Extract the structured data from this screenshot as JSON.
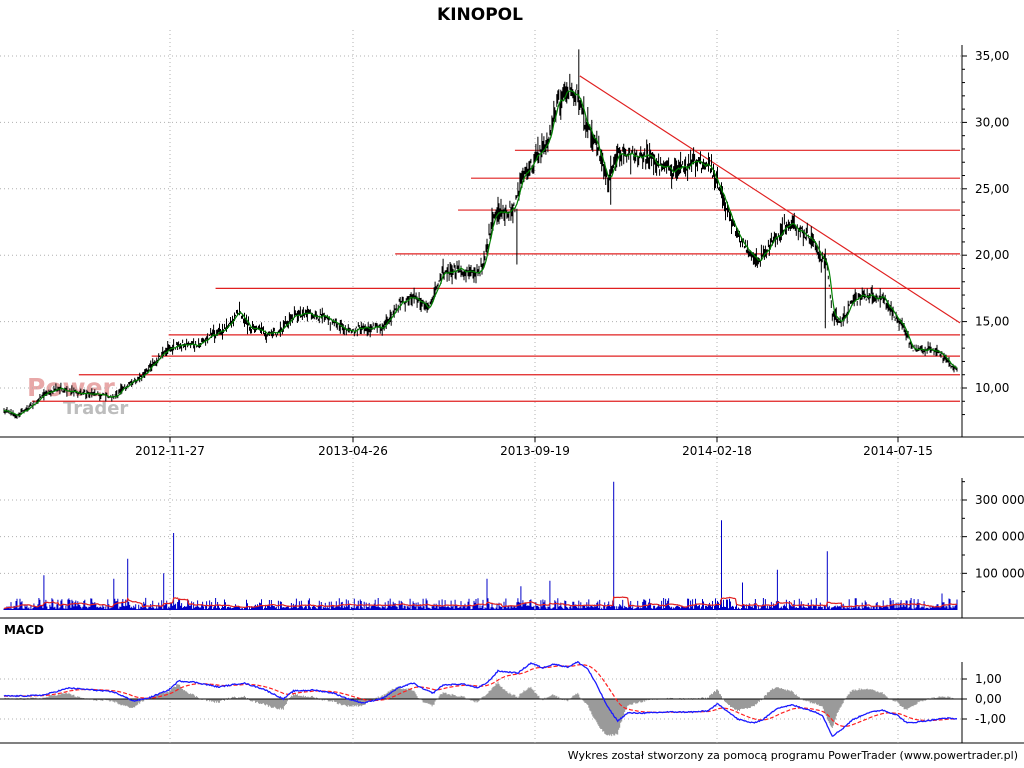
{
  "title": "KINOPOL",
  "watermark": {
    "line1": "Power",
    "line2": "Trader"
  },
  "footer": "Wykres został stworzony za pomocą programu PowerTrader (www.powertrader.pl)",
  "colors": {
    "price_bars": "#000000",
    "price_ma": "#008000",
    "support_lines": "#e02020",
    "volume_bars": "#0000c8",
    "volume_ma": "#e02020",
    "macd_line": "#1a1aff",
    "macd_signal": "#ff2020",
    "histogram": "#9a9a9a",
    "grid": "#b0b0b0"
  },
  "chart_data": [
    {
      "type": "ohlc",
      "pane": "price",
      "x_tick_labels": [
        "2012-11-27",
        "2013-04-26",
        "2013-09-19",
        "2014-02-18",
        "2014-07-15"
      ],
      "ylim": [
        7.0,
        35.5
      ],
      "y_ticks": [
        10,
        15,
        20,
        25,
        30,
        35
      ],
      "y_tick_labels": [
        "10,00",
        "15,00",
        "20,00",
        "25,00",
        "30,00",
        "35,00"
      ],
      "close_waypoints": [
        [
          0,
          8.3
        ],
        [
          12,
          7.9
        ],
        [
          25,
          8.5
        ],
        [
          40,
          9.5
        ],
        [
          55,
          10.0
        ],
        [
          75,
          9.6
        ],
        [
          95,
          9.5
        ],
        [
          110,
          9.3
        ],
        [
          125,
          10.3
        ],
        [
          135,
          10.7
        ],
        [
          150,
          11.8
        ],
        [
          160,
          12.8
        ],
        [
          175,
          13.2
        ],
        [
          195,
          13.3
        ],
        [
          210,
          14.0
        ],
        [
          225,
          14.6
        ],
        [
          235,
          15.8
        ],
        [
          245,
          14.6
        ],
        [
          260,
          14.2
        ],
        [
          275,
          14.2
        ],
        [
          290,
          15.4
        ],
        [
          305,
          15.6
        ],
        [
          320,
          15.3
        ],
        [
          335,
          14.8
        ],
        [
          345,
          14.2
        ],
        [
          360,
          14.6
        ],
        [
          380,
          14.6
        ],
        [
          395,
          16.3
        ],
        [
          410,
          16.9
        ],
        [
          425,
          16.0
        ],
        [
          440,
          18.6
        ],
        [
          455,
          19.0
        ],
        [
          470,
          18.6
        ],
        [
          480,
          19.0
        ],
        [
          490,
          23.0
        ],
        [
          500,
          23.4
        ],
        [
          510,
          23.3
        ],
        [
          520,
          26.0
        ],
        [
          530,
          27.0
        ],
        [
          545,
          28.5
        ],
        [
          555,
          31.5
        ],
        [
          565,
          32.5
        ],
        [
          575,
          32.0
        ],
        [
          585,
          29.5
        ],
        [
          595,
          28.0
        ],
        [
          605,
          25.5
        ],
        [
          615,
          27.5
        ],
        [
          630,
          27.5
        ],
        [
          645,
          27.5
        ],
        [
          660,
          26.5
        ],
        [
          675,
          26.5
        ],
        [
          690,
          26.8
        ],
        [
          705,
          27.0
        ],
        [
          715,
          25.5
        ],
        [
          725,
          23.5
        ],
        [
          735,
          21.5
        ],
        [
          745,
          20.5
        ],
        [
          755,
          19.5
        ],
        [
          765,
          20.5
        ],
        [
          775,
          21.5
        ],
        [
          785,
          22.5
        ],
        [
          795,
          22.0
        ],
        [
          805,
          21.5
        ],
        [
          815,
          20.5
        ],
        [
          825,
          19.0
        ],
        [
          830,
          15.5
        ],
        [
          840,
          15.0
        ],
        [
          850,
          16.5
        ],
        [
          860,
          17.0
        ],
        [
          870,
          16.9
        ],
        [
          880,
          16.9
        ],
        [
          890,
          15.8
        ],
        [
          900,
          14.6
        ],
        [
          910,
          13.0
        ],
        [
          920,
          12.8
        ],
        [
          930,
          12.9
        ],
        [
          940,
          12.5
        ],
        [
          955,
          11.3
        ]
      ],
      "horizontal_levels": [
        {
          "from": 28,
          "value": 9.0
        },
        {
          "from": 75,
          "value": 11.0
        },
        {
          "from": 148,
          "value": 12.4
        },
        {
          "from": 165,
          "value": 14.0
        },
        {
          "from": 212,
          "value": 17.5
        },
        {
          "from": 392,
          "value": 20.1
        },
        {
          "from": 455,
          "value": 23.4
        },
        {
          "from": 468,
          "value": 25.8
        },
        {
          "from": 512,
          "value": 27.9
        }
      ],
      "trendline": {
        "from": [
          577,
          33.5
        ],
        "to": [
          960,
          14.9
        ]
      }
    },
    {
      "type": "bar",
      "pane": "volume",
      "ylim": [
        0,
        350000
      ],
      "y_ticks": [
        100000,
        200000,
        300000
      ],
      "y_tick_labels": [
        "100 000",
        "200 000",
        "300 000"
      ],
      "spikes": [
        [
          40,
          95000
        ],
        [
          110,
          85000
        ],
        [
          124,
          140000
        ],
        [
          160,
          100000
        ],
        [
          170,
          210000
        ],
        [
          484,
          85000
        ],
        [
          518,
          65000
        ],
        [
          547,
          80000
        ],
        [
          611,
          350000
        ],
        [
          719,
          245000
        ],
        [
          740,
          75000
        ],
        [
          775,
          110000
        ],
        [
          825,
          160000
        ],
        [
          940,
          45000
        ]
      ]
    },
    {
      "type": "line",
      "pane": "macd",
      "title": "MACD",
      "ylim": [
        -2.0,
        2.0
      ],
      "y_ticks": [
        1.0,
        0.0,
        -1.0
      ],
      "y_tick_labels": [
        "1,00",
        "0,00",
        "-1,00"
      ],
      "macd_waypoints": [
        [
          0,
          0.15
        ],
        [
          20,
          0.15
        ],
        [
          40,
          0.2
        ],
        [
          65,
          0.55
        ],
        [
          90,
          0.45
        ],
        [
          110,
          0.35
        ],
        [
          130,
          -0.1
        ],
        [
          145,
          0.05
        ],
        [
          165,
          0.45
        ],
        [
          175,
          0.9
        ],
        [
          190,
          0.85
        ],
        [
          215,
          0.6
        ],
        [
          240,
          0.8
        ],
        [
          260,
          0.5
        ],
        [
          280,
          0.0
        ],
        [
          290,
          0.4
        ],
        [
          310,
          0.45
        ],
        [
          330,
          0.3
        ],
        [
          345,
          0.0
        ],
        [
          360,
          -0.2
        ],
        [
          380,
          0.05
        ],
        [
          395,
          0.55
        ],
        [
          410,
          0.8
        ],
        [
          420,
          0.5
        ],
        [
          430,
          0.3
        ],
        [
          440,
          0.7
        ],
        [
          460,
          0.75
        ],
        [
          475,
          0.55
        ],
        [
          485,
          0.85
        ],
        [
          495,
          1.4
        ],
        [
          505,
          1.35
        ],
        [
          515,
          1.3
        ],
        [
          528,
          1.8
        ],
        [
          540,
          1.55
        ],
        [
          550,
          1.75
        ],
        [
          565,
          1.6
        ],
        [
          575,
          1.85
        ],
        [
          585,
          1.5
        ],
        [
          595,
          0.6
        ],
        [
          605,
          -0.4
        ],
        [
          615,
          -1.1
        ],
        [
          625,
          -0.7
        ],
        [
          645,
          -0.7
        ],
        [
          665,
          -0.65
        ],
        [
          690,
          -0.65
        ],
        [
          705,
          -0.6
        ],
        [
          715,
          -0.25
        ],
        [
          725,
          -0.6
        ],
        [
          735,
          -1.0
        ],
        [
          750,
          -1.2
        ],
        [
          760,
          -1.05
        ],
        [
          775,
          -0.45
        ],
        [
          790,
          -0.3
        ],
        [
          810,
          -0.6
        ],
        [
          820,
          -0.8
        ],
        [
          830,
          -1.85
        ],
        [
          840,
          -1.5
        ],
        [
          850,
          -1.05
        ],
        [
          865,
          -0.7
        ],
        [
          880,
          -0.55
        ],
        [
          895,
          -0.8
        ],
        [
          905,
          -1.2
        ],
        [
          915,
          -1.15
        ],
        [
          930,
          -1.05
        ],
        [
          945,
          -0.95
        ],
        [
          955,
          -1.0
        ]
      ]
    }
  ]
}
